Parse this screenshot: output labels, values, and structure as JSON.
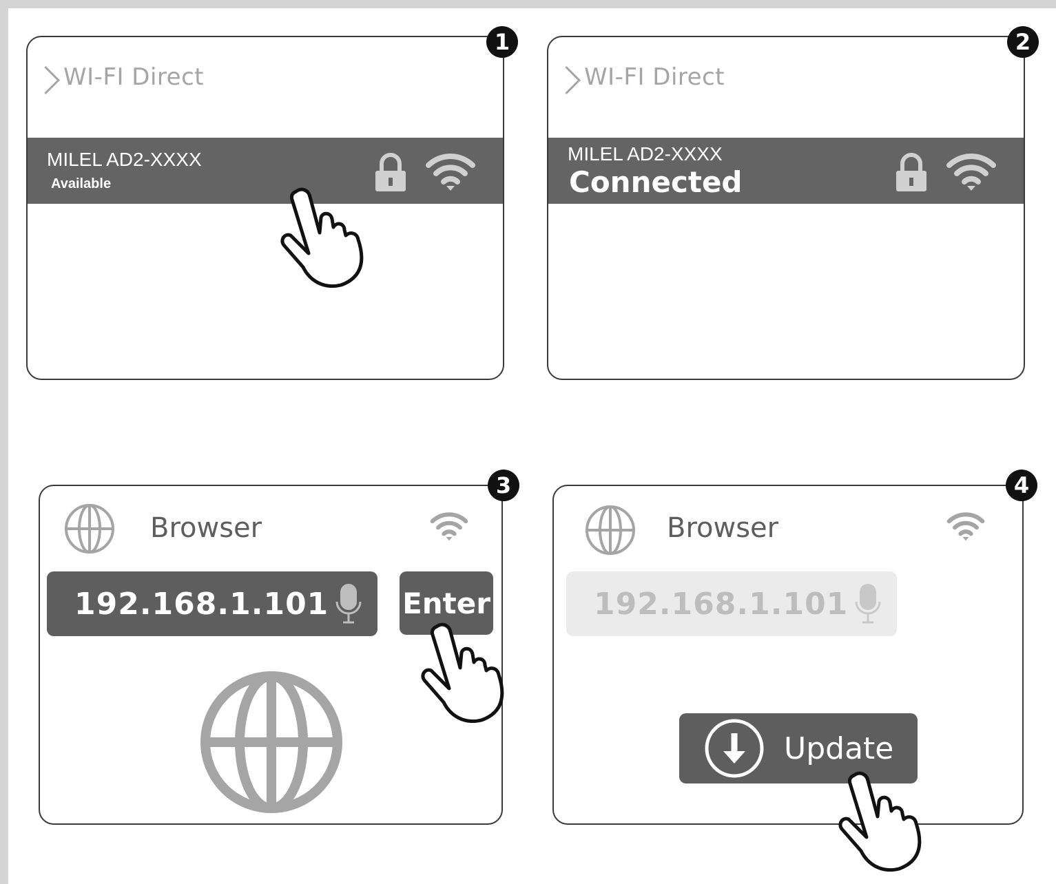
{
  "steps": [
    {
      "number": "1",
      "header": "WI-FI Direct",
      "network": {
        "name": "MILEL AD2-XXXX",
        "status": "Available"
      },
      "icons": [
        "lock-icon",
        "wifi-icon"
      ],
      "pointer": "hand-pointer-icon"
    },
    {
      "number": "2",
      "header": "WI-FI Direct",
      "network": {
        "name": "MILEL AD2-XXXX",
        "status": "Connected"
      },
      "icons": [
        "lock-icon",
        "wifi-icon"
      ]
    },
    {
      "number": "3",
      "app_title": "Browser",
      "url_value": "192.168.1.101",
      "enter_label": "Enter",
      "icons": [
        "globe-icon",
        "wifi-icon",
        "microphone-icon"
      ],
      "pointer": "hand-pointer-icon"
    },
    {
      "number": "4",
      "app_title": "Browser",
      "url_value": "192.168.1.101",
      "update_label": "Update",
      "icons": [
        "globe-icon",
        "wifi-icon",
        "microphone-icon",
        "download-icon"
      ],
      "pointer": "hand-pointer-icon"
    }
  ],
  "colors": {
    "row_dark": "#646464",
    "button_dark": "#5e5e5e",
    "muted_text": "#a5a5a5",
    "url_light_bg": "#ebebeb",
    "badge": "#111111"
  }
}
